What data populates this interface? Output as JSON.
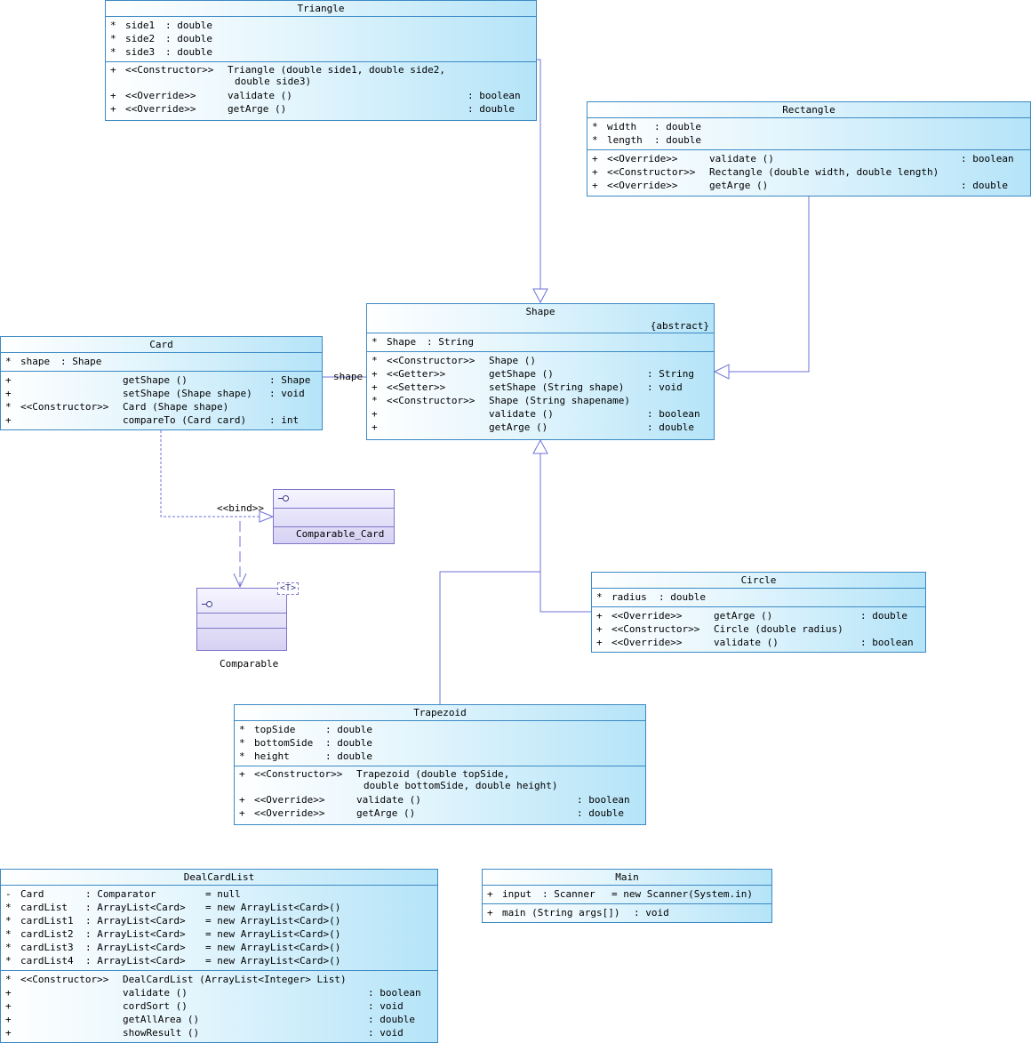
{
  "classes": {
    "triangle": {
      "name": "Triangle",
      "attributes": [
        {
          "vis": "*",
          "name": "side1",
          "type": ": double"
        },
        {
          "vis": "*",
          "name": "side2",
          "type": ": double"
        },
        {
          "vis": "*",
          "name": "side3",
          "type": ": double"
        }
      ],
      "operations": [
        {
          "vis": "+",
          "stereo": "<<Constructor>>",
          "sig": "Triangle (double side1, double side2,",
          "cont": "double side3)",
          "ret": ""
        },
        {
          "vis": "+",
          "stereo": "<<Override>>",
          "sig": "validate ()",
          "ret": ": boolean"
        },
        {
          "vis": "+",
          "stereo": "<<Override>>",
          "sig": "getArge ()",
          "ret": ": double"
        }
      ]
    },
    "rectangle": {
      "name": "Rectangle",
      "attributes": [
        {
          "vis": "*",
          "name": "width",
          "type": ": double"
        },
        {
          "vis": "*",
          "name": "length",
          "type": ": double"
        }
      ],
      "operations": [
        {
          "vis": "+",
          "stereo": "<<Override>>",
          "sig": "validate ()",
          "ret": ": boolean"
        },
        {
          "vis": "+",
          "stereo": "<<Constructor>>",
          "sig": "Rectangle (double width, double length)",
          "ret": ""
        },
        {
          "vis": "+",
          "stereo": "<<Override>>",
          "sig": "getArge ()",
          "ret": ": double"
        }
      ]
    },
    "shape": {
      "name": "Shape",
      "stereotype": "{abstract}",
      "attributes": [
        {
          "vis": "*",
          "name": "Shape",
          "type": ": String"
        }
      ],
      "operations": [
        {
          "vis": "*",
          "stereo": "<<Constructor>>",
          "sig": "Shape ()",
          "ret": ""
        },
        {
          "vis": "+",
          "stereo": "<<Getter>>",
          "sig": "getShape ()",
          "ret": ": String"
        },
        {
          "vis": "+",
          "stereo": "<<Setter>>",
          "sig": "setShape (String shape)",
          "ret": ": void"
        },
        {
          "vis": "*",
          "stereo": "<<Constructor>>",
          "sig": "Shape (String shapename)",
          "ret": ""
        },
        {
          "vis": "+",
          "stereo": "",
          "sig": "validate ()",
          "ret": ": boolean"
        },
        {
          "vis": "+",
          "stereo": "",
          "sig": "getArge ()",
          "ret": ": double"
        }
      ]
    },
    "card": {
      "name": "Card",
      "attributes": [
        {
          "vis": "*",
          "name": "shape",
          "type": ": Shape"
        }
      ],
      "operations": [
        {
          "vis": "+",
          "stereo": "",
          "sig": "getShape ()",
          "ret": ": Shape"
        },
        {
          "vis": "+",
          "stereo": "",
          "sig": "setShape (Shape shape)",
          "ret": ": void"
        },
        {
          "vis": "*",
          "stereo": "<<Constructor>>",
          "sig": "Card (Shape shape)",
          "ret": ""
        },
        {
          "vis": "+",
          "stereo": "",
          "sig": "compareTo (Card card)",
          "ret": ": int"
        }
      ]
    },
    "circle": {
      "name": "Circle",
      "attributes": [
        {
          "vis": "*",
          "name": "radius",
          "type": ": double"
        }
      ],
      "operations": [
        {
          "vis": "+",
          "stereo": "<<Override>>",
          "sig": "getArge ()",
          "ret": ": double"
        },
        {
          "vis": "+",
          "stereo": "<<Constructor>>",
          "sig": "Circle (double radius)",
          "ret": ""
        },
        {
          "vis": "+",
          "stereo": "<<Override>>",
          "sig": "validate ()",
          "ret": ": boolean"
        }
      ]
    },
    "trapezoid": {
      "name": "Trapezoid",
      "attributes": [
        {
          "vis": "*",
          "name": "topSide",
          "type": ": double"
        },
        {
          "vis": "*",
          "name": "bottomSide",
          "type": ": double"
        },
        {
          "vis": "*",
          "name": "height",
          "type": ": double"
        }
      ],
      "operations": [
        {
          "vis": "+",
          "stereo": "<<Constructor>>",
          "sig": "Trapezoid (double topSide,",
          "cont": "double bottomSide, double height)",
          "ret": ""
        },
        {
          "vis": "+",
          "stereo": "<<Override>>",
          "sig": "validate ()",
          "ret": ": boolean"
        },
        {
          "vis": "+",
          "stereo": "<<Override>>",
          "sig": "getArge ()",
          "ret": ": double"
        }
      ]
    },
    "dealcardlist": {
      "name": "DealCardList",
      "attributes": [
        {
          "vis": "-",
          "name": "Card",
          "type": ": Comparator",
          "init": "= null"
        },
        {
          "vis": "*",
          "name": "cardList",
          "type": ": ArrayList<Card>",
          "init": "= new ArrayList<Card>()"
        },
        {
          "vis": "*",
          "name": "cardList1",
          "type": ": ArrayList<Card>",
          "init": "= new ArrayList<Card>()"
        },
        {
          "vis": "*",
          "name": "cardList2",
          "type": ": ArrayList<Card>",
          "init": "= new ArrayList<Card>()"
        },
        {
          "vis": "*",
          "name": "cardList3",
          "type": ": ArrayList<Card>",
          "init": "= new ArrayList<Card>()"
        },
        {
          "vis": "*",
          "name": "cardList4",
          "type": ": ArrayList<Card>",
          "init": "= new ArrayList<Card>()"
        }
      ],
      "operations": [
        {
          "vis": "*",
          "stereo": "<<Constructor>>",
          "sig": "DealCardList (ArrayList<Integer> List)",
          "ret": ""
        },
        {
          "vis": "+",
          "stereo": "",
          "sig": "validate ()",
          "ret": ": boolean"
        },
        {
          "vis": "+",
          "stereo": "",
          "sig": "cordSort ()",
          "ret": ": void"
        },
        {
          "vis": "+",
          "stereo": "",
          "sig": "getAllArea ()",
          "ret": ": double"
        },
        {
          "vis": "+",
          "stereo": "",
          "sig": "showResult ()",
          "ret": ": void"
        }
      ]
    },
    "main": {
      "name": "Main",
      "attributes": [
        {
          "vis": "+",
          "name": "input",
          "type": ": Scanner",
          "init": "= new Scanner(System.in)"
        }
      ],
      "operations": [
        {
          "vis": "+",
          "stereo": "",
          "sig": "main (String args[])",
          "ret": ": void"
        }
      ]
    }
  },
  "interfaces": {
    "comparable_card": {
      "name": "Comparable_Card"
    },
    "comparable": {
      "name": "Comparable",
      "type_param": "<T>"
    }
  },
  "relations": {
    "card_shape_role": "shape",
    "bind_label": "<<bind>>"
  },
  "colors": {
    "class_border": "#3c8ac4",
    "class_fill_end": "#b5e4f8",
    "interface_border": "#7d76c8",
    "line": "#6f73d8"
  }
}
